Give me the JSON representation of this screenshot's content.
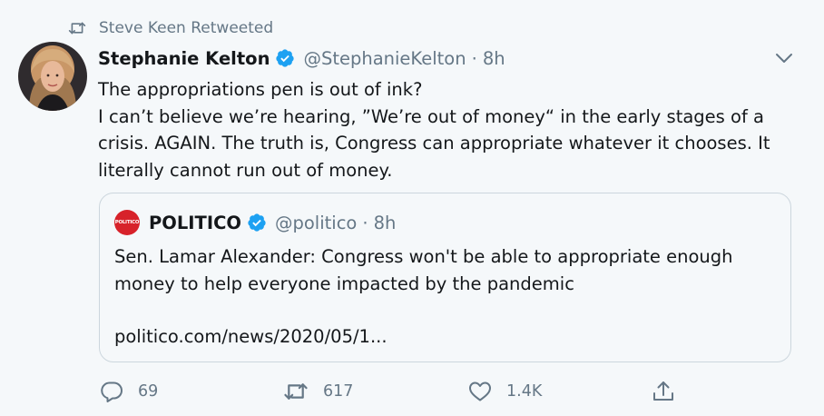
{
  "retweet_context": {
    "icon": "retweet-icon",
    "text": "Steve Keen Retweeted"
  },
  "tweet": {
    "avatar": "avatar",
    "author_name": "Stephanie Kelton",
    "verified": true,
    "handle": "@StephanieKelton",
    "separator": "·",
    "time": "8h",
    "menu_icon": "chevron-down-icon",
    "text_lines": [
      "The appropriations pen is out of ink?",
      "I can’t believe we’re hearing, ”We’re out of money“ in the early stages of a crisis. AGAIN. The truth is, Congress can appropriate whatever it chooses. It literally cannot run out of money."
    ]
  },
  "quoted_tweet": {
    "logo_text": "POLITICO",
    "author_name": "POLITICO",
    "verified": true,
    "handle": "@politico",
    "separator": "·",
    "time": "8h",
    "text": "Sen. Lamar Alexander: Congress won't be able to appropriate enough money to help everyone impacted by the pandemic",
    "link": "politico.com/news/2020/05/1..."
  },
  "actions": {
    "reply": {
      "icon": "reply-icon",
      "count": "69"
    },
    "retweet": {
      "icon": "retweet-icon",
      "count": "617"
    },
    "like": {
      "icon": "heart-icon",
      "count": "1.4K"
    },
    "share": {
      "icon": "share-icon"
    }
  },
  "colors": {
    "background": "#f5f8fa",
    "secondary_text": "#657786",
    "verified_blue": "#1da1f2",
    "politico_red": "#d7222a",
    "border": "#ccd6dd"
  }
}
